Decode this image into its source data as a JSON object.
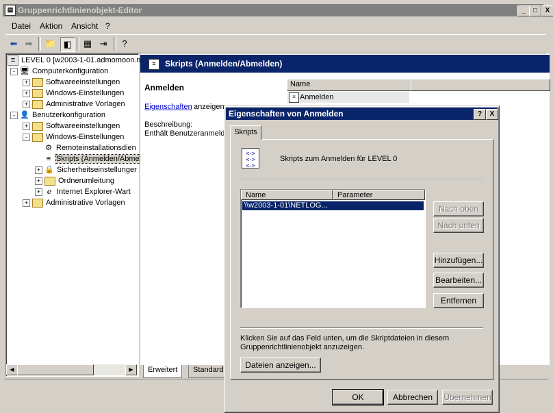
{
  "window": {
    "title": "Gruppenrichtlinienobjekt-Editor",
    "caption_buttons": [
      "_",
      "□",
      "X"
    ]
  },
  "menu": {
    "items": [
      "Datei",
      "Aktion",
      "Ansicht",
      "?"
    ]
  },
  "toolbar": {
    "buttons": [
      "back-icon",
      "forward-icon",
      "up-folder-icon",
      "show-hide-tree-icon",
      "properties-icon",
      "export-list-icon",
      "help-icon"
    ]
  },
  "tree": {
    "root": "LEVEL 0 [w2003-1-01.admomoon.net",
    "items": [
      {
        "label": "Computerkonfiguration",
        "level": 1,
        "exp": "−",
        "icon": "computer-icon"
      },
      {
        "label": "Softwareeinstellungen",
        "level": 2,
        "exp": "+",
        "icon": "folder-icon"
      },
      {
        "label": "Windows-Einstellungen",
        "level": 2,
        "exp": "+",
        "icon": "folder-icon"
      },
      {
        "label": "Administrative Vorlagen",
        "level": 2,
        "exp": "+",
        "icon": "folder-icon"
      },
      {
        "label": "Benutzerkonfiguration",
        "level": 1,
        "exp": "−",
        "icon": "user-icon"
      },
      {
        "label": "Softwareeinstellungen",
        "level": 2,
        "exp": "+",
        "icon": "folder-icon"
      },
      {
        "label": "Windows-Einstellungen",
        "level": 2,
        "exp": "−",
        "icon": "folder-icon"
      },
      {
        "label": "Remoteinstallationsdien",
        "level": 3,
        "exp": "",
        "icon": "remote-install-icon"
      },
      {
        "label": "Skripts (Anmelden/Abme",
        "level": 3,
        "exp": "",
        "icon": "script-icon",
        "selected": true
      },
      {
        "label": "Sicherheitseinstellunger",
        "level": 3,
        "exp": "+",
        "icon": "security-icon"
      },
      {
        "label": "Ordnerumleitung",
        "level": 3,
        "exp": "+",
        "icon": "folder-icon"
      },
      {
        "label": "Internet Explorer-Wart",
        "level": 3,
        "exp": "+",
        "icon": "ie-icon"
      },
      {
        "label": "Administrative Vorlagen",
        "level": 2,
        "exp": "+",
        "icon": "folder-icon"
      }
    ]
  },
  "right": {
    "header_title": "Skripts (Anmelden/Abmelden)",
    "section_title": "Anmelden",
    "properties_link": "Eigenschaften",
    "properties_suffix": "anzeigen",
    "description_label": "Beschreibung:",
    "description_text": "Enthält Benutzeranmeld",
    "list_header_name": "Name",
    "list_item": "Anmelden"
  },
  "bottom_tabs": [
    "Erweitert",
    "Standard"
  ],
  "dialog": {
    "title": "Eigenschaften von Anmelden",
    "title_buttons": [
      "?",
      "X"
    ],
    "tab": "Skripts",
    "heading": "Skripts zum Anmelden für LEVEL 0",
    "columns": [
      "Name",
      "Parameter"
    ],
    "rows": [
      {
        "name": "\\\\w2003-1-01\\NETLOG...",
        "param": ""
      }
    ],
    "side_buttons": [
      {
        "label": "Nach oben",
        "disabled": true
      },
      {
        "label": "Nach unten",
        "disabled": true
      },
      {
        "label": "Hinzufügen...",
        "disabled": false
      },
      {
        "label": "Bearbeiten...",
        "disabled": false
      },
      {
        "label": "Entfernen",
        "disabled": false
      }
    ],
    "hint": "Klicken Sie auf das Feld unten, um die Skriptdateien in diesem Gruppenrichtlinienobjekt anzuzeigen.",
    "show_files_button": "Dateien anzeigen...",
    "ok": "OK",
    "cancel": "Abbrechen",
    "apply": "Übernehmen"
  },
  "colors": {
    "selection": "#0a246a",
    "inactive_title": "#808080",
    "face": "#d4d0c8"
  }
}
